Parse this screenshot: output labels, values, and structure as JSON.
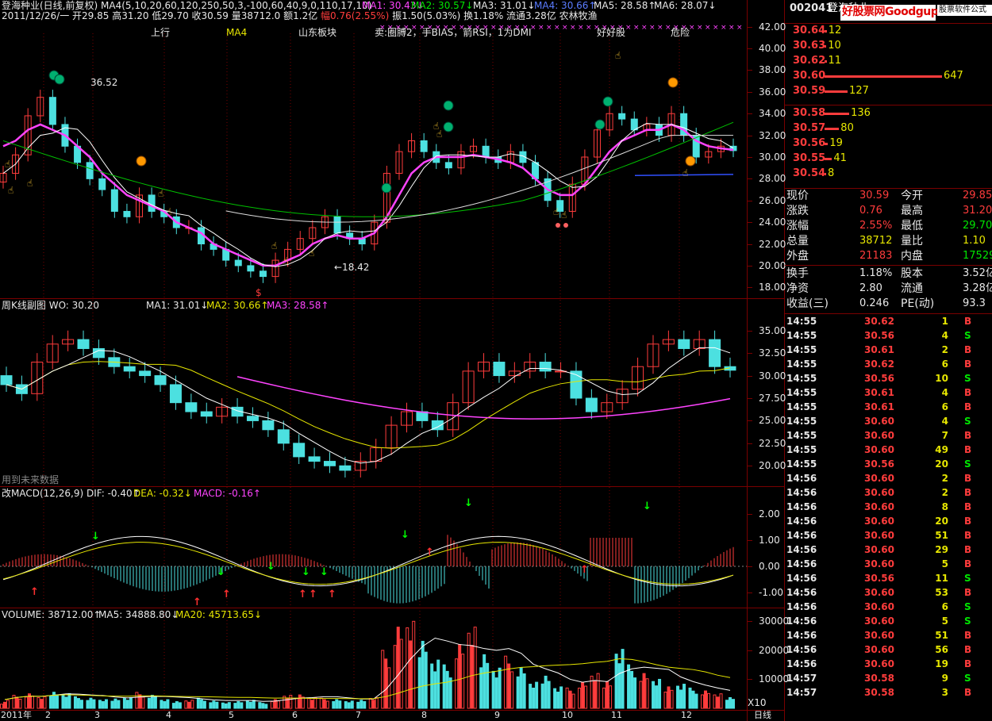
{
  "header": {
    "stock_name": "登海种业(日线,前复权)",
    "ma_params": "MA4(5,10,20,60,120,250,50,3,-100,60,40,9,0,110,17,10)",
    "ma1": "MA1: 30.43↓",
    "ma2": "MA2: 30.57↓",
    "ma3": "MA3: 31.01↓",
    "ma4": "MA4: 30.66↑",
    "ma5": "MA5: 28.58↑",
    "ma6": "MA6: 28.07↓",
    "line2": "2011/12/26/一 开29.85 高31.20 低29.70 收30.59 量38712.0 额1.2亿",
    "change_text": "幅0.76(2.55%)",
    "line2b": "振1.50(5.03%) 换1.18% 流通3.28亿 农林牧渔"
  },
  "main_annotations": [
    "上行",
    "MA4",
    "山东板块",
    "卖:圈膊2，手BIAS，箭RSI，1为DMI",
    "好好股",
    "危险"
  ],
  "price_labels": {
    "high": "36.52",
    "low": "←18.42"
  },
  "right_axis": {
    "main": [
      "42.00",
      "40.00",
      "38.00",
      "36.00",
      "34.00",
      "32.00",
      "30.00",
      "28.00",
      "26.00",
      "24.00",
      "22.00",
      "20.00",
      "18.00"
    ],
    "weekly": [
      "35.00",
      "32.50",
      "30.00",
      "27.50",
      "25.00",
      "22.50",
      "20.00"
    ],
    "macd": [
      "2.00",
      "1.00",
      "0.00",
      "-1.00"
    ],
    "volume": [
      "30000",
      "20000",
      "10000"
    ],
    "vol_unit": "X10"
  },
  "weekly_panel": {
    "title": "周K线副图",
    "wo": "WO: 30.20",
    "ma1": "MA1: 31.01↓",
    "ma2": "MA2: 30.66↑",
    "ma3": "MA3: 28.58↑",
    "note": "用到未来数据"
  },
  "macd_panel": {
    "title": "改MACD(12,26,9)",
    "dif": "DIF: -0.40↑",
    "dea": "DEA: -0.32↓",
    "macd": "MACD: -0.16↑"
  },
  "volume_panel": {
    "vol": "VOLUME: 38712.00↑",
    "ma5": "MA5: 34888.80↓",
    "ma20": "MA20: 45713.65↓"
  },
  "x_axis": {
    "year": "2011年",
    "months": [
      "2",
      "3",
      "4",
      "5",
      "6",
      "7",
      "8",
      "9",
      "10",
      "11",
      "12"
    ],
    "period": "日线"
  },
  "right_panel": {
    "code": "002041",
    "name_partial": "登海种业",
    "watermark": "好股票网Goodgupiao.com",
    "brand": "股票软件公式",
    "asks": [
      {
        "price": "30.64",
        "vol": "12"
      },
      {
        "price": "30.63",
        "vol": "10"
      },
      {
        "price": "30.62",
        "vol": "11"
      },
      {
        "price": "30.60",
        "vol": "647"
      },
      {
        "price": "30.59",
        "vol": "127"
      }
    ],
    "bids": [
      {
        "price": "30.58",
        "vol": "136"
      },
      {
        "price": "30.57",
        "vol": "80"
      },
      {
        "price": "30.56",
        "vol": "19"
      },
      {
        "price": "30.55",
        "vol": "41"
      },
      {
        "price": "30.54",
        "vol": "8"
      }
    ],
    "stats": [
      {
        "l1": "现价",
        "v1": "30.59",
        "l2": "今开",
        "v2": "29.85"
      },
      {
        "l1": "涨跌",
        "v1": "0.76",
        "l2": "最高",
        "v2": "31.20"
      },
      {
        "l1": "涨幅",
        "v1": "2.55%",
        "l2": "最低",
        "v2": "29.70"
      },
      {
        "l1": "总量",
        "v1": "38712",
        "l2": "量比",
        "v2": "1.10"
      },
      {
        "l1": "外盘",
        "v1": "21183",
        "l2": "内盘",
        "v2": "17529"
      },
      {
        "l1": "换手",
        "v1": "1.18%",
        "l2": "股本",
        "v2": "3.52亿"
      },
      {
        "l1": "净资",
        "v1": "2.80",
        "l2": "流通",
        "v2": "3.28亿"
      },
      {
        "l1": "收益(三)",
        "v1": "0.246",
        "l2": "PE(动)",
        "v2": "93.3"
      }
    ],
    "ticks": [
      {
        "t": "14:55",
        "p": "30.62",
        "v": "1",
        "d": "B"
      },
      {
        "t": "14:55",
        "p": "30.56",
        "v": "4",
        "d": "S"
      },
      {
        "t": "14:55",
        "p": "30.61",
        "v": "2",
        "d": "B"
      },
      {
        "t": "14:55",
        "p": "30.62",
        "v": "6",
        "d": "B"
      },
      {
        "t": "14:55",
        "p": "30.56",
        "v": "10",
        "d": "S"
      },
      {
        "t": "14:55",
        "p": "30.61",
        "v": "4",
        "d": "B"
      },
      {
        "t": "14:55",
        "p": "30.61",
        "v": "6",
        "d": "B"
      },
      {
        "t": "14:55",
        "p": "30.60",
        "v": "4",
        "d": "S"
      },
      {
        "t": "14:55",
        "p": "30.60",
        "v": "7",
        "d": "B"
      },
      {
        "t": "14:55",
        "p": "30.60",
        "v": "49",
        "d": "B"
      },
      {
        "t": "14:55",
        "p": "30.56",
        "v": "20",
        "d": "S"
      },
      {
        "t": "14:56",
        "p": "30.60",
        "v": "2",
        "d": "B"
      },
      {
        "t": "14:56",
        "p": "30.60",
        "v": "2",
        "d": "B"
      },
      {
        "t": "14:56",
        "p": "30.60",
        "v": "8",
        "d": "B"
      },
      {
        "t": "14:56",
        "p": "30.60",
        "v": "20",
        "d": "B"
      },
      {
        "t": "14:56",
        "p": "30.60",
        "v": "51",
        "d": "B"
      },
      {
        "t": "14:56",
        "p": "30.60",
        "v": "29",
        "d": "B"
      },
      {
        "t": "14:56",
        "p": "30.60",
        "v": "5",
        "d": "B"
      },
      {
        "t": "14:56",
        "p": "30.56",
        "v": "11",
        "d": "S"
      },
      {
        "t": "14:56",
        "p": "30.60",
        "v": "53",
        "d": "B"
      },
      {
        "t": "14:56",
        "p": "30.60",
        "v": "6",
        "d": "S"
      },
      {
        "t": "14:56",
        "p": "30.60",
        "v": "5",
        "d": "S"
      },
      {
        "t": "14:56",
        "p": "30.60",
        "v": "51",
        "d": "B"
      },
      {
        "t": "14:56",
        "p": "30.60",
        "v": "56",
        "d": "B"
      },
      {
        "t": "14:56",
        "p": "30.60",
        "v": "19",
        "d": "B"
      },
      {
        "t": "14:57",
        "p": "30.58",
        "v": "9",
        "d": "S"
      },
      {
        "t": "14:57",
        "p": "30.58",
        "v": "3",
        "d": "B"
      }
    ]
  },
  "colors": {
    "up": "#ff3c3c",
    "down": "#4ce0e0",
    "grid": "#7a0000",
    "ma_magenta": "#ff44ff",
    "ma_yellow": "#e6e600"
  },
  "chart_data": [
    {
      "type": "candlestick",
      "title": "登海种业(日线,前复权)",
      "ylim": [
        17,
        43
      ],
      "x": [
        "2",
        "3",
        "4",
        "5",
        "6",
        "7",
        "8",
        "9",
        "10",
        "11",
        "12"
      ],
      "series": [
        {
          "name": "close",
          "values": [
            28.5,
            30.2,
            33.8,
            35.5,
            33.0,
            31.0,
            29.5,
            28.0,
            27.0,
            25.0,
            24.5,
            26.5,
            25.0,
            24.5,
            23.5,
            23.5,
            22.0,
            21.5,
            20.5,
            20.0,
            19.5,
            19.0,
            20.5,
            21.5,
            22.5,
            23.5,
            24.5,
            23.0,
            22.5,
            22.0,
            24.0,
            28.5,
            30.5,
            31.5,
            30.5,
            29.5,
            29.0,
            30.5,
            31.0,
            30.0,
            29.5,
            30.5,
            29.5,
            28.0,
            26.0,
            25.0,
            27.5,
            30.0,
            32.5,
            34.0,
            33.5,
            32.5,
            33.0,
            32.0,
            34.0,
            32.0,
            30.0,
            30.5,
            31.0,
            30.59
          ]
        },
        {
          "name": "ma_magenta",
          "values": [
            31.0,
            31.5,
            32.5,
            33.0,
            32.5,
            32.0,
            31.0,
            30.0,
            28.5,
            27.5,
            26.5,
            26.0,
            25.5,
            25.0,
            24.0,
            23.5,
            23.0,
            22.0,
            21.5,
            21.0,
            20.5,
            20.0,
            20.0,
            20.5,
            21.0,
            22.0,
            22.5,
            22.8,
            22.5,
            22.5,
            23.0,
            24.5,
            26.5,
            28.5,
            29.5,
            30.0,
            30.0,
            30.0,
            30.2,
            30.0,
            29.8,
            29.5,
            29.0,
            28.0,
            27.0,
            26.5,
            26.5,
            27.5,
            29.0,
            30.5,
            31.5,
            32.0,
            32.5,
            32.5,
            33.0,
            32.5,
            31.5,
            31.0,
            30.8,
            30.66
          ]
        }
      ]
    },
    {
      "type": "bar",
      "title": "VOLUME",
      "ylim": [
        0,
        32000
      ],
      "values": [
        3000,
        4500,
        5000,
        4000,
        6000,
        5500,
        4000,
        3500,
        3000,
        3500,
        4000,
        5500,
        4500,
        3000,
        2500,
        3000,
        3500,
        2500,
        2000,
        2500,
        3000,
        2000,
        3000,
        4500,
        5000,
        4000,
        3500,
        3000,
        2500,
        3000,
        4000,
        20000,
        28000,
        30000,
        25000,
        18000,
        15000,
        22000,
        28000,
        20000,
        15000,
        18000,
        14000,
        9000,
        12000,
        8000,
        7000,
        9000,
        12000,
        10000,
        22000,
        15000,
        12000,
        10000,
        8000,
        9000,
        7000,
        6000,
        5000,
        4000
      ]
    }
  ]
}
